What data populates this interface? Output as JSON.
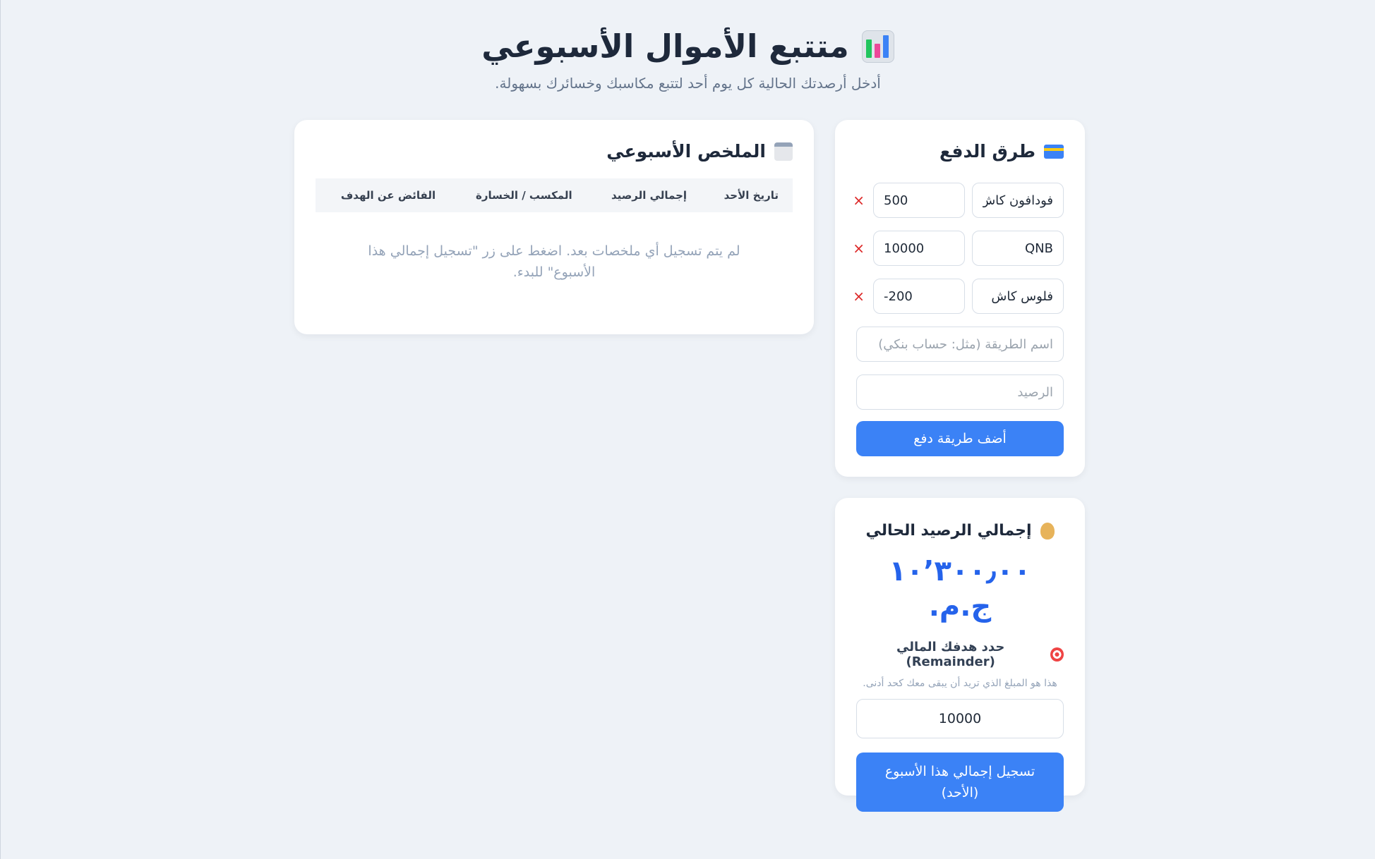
{
  "header": {
    "title": "متتبع الأموال الأسبوعي",
    "subtitle": "أدخل أرصدتك الحالية كل يوم أحد لتتبع مكاسبك وخسائرك بسهولة."
  },
  "payment": {
    "title": "طرق الدفع",
    "methods": [
      {
        "name": "فودافون كاش",
        "balance": "500"
      },
      {
        "name": "QNB",
        "balance": "10000"
      },
      {
        "name": "فلوس كاش",
        "balance": "-200"
      }
    ],
    "remove_label": "×",
    "name_placeholder": "اسم الطريقة (مثل: حساب بنكي)",
    "balance_placeholder": "الرصيد",
    "add_button": "أضف طريقة دفع"
  },
  "total": {
    "title": "إجمالي الرصيد الحالي",
    "value": "١٠٬٣٠٠٫٠٠ ج.م.",
    "goal_label": "حدد هدفك المالي (Remainder)",
    "goal_hint": "هذا هو المبلغ الذي تريد أن يبقى معك كحد أدنى.",
    "goal_value": "10000",
    "record_button": "تسجيل إجمالي هذا الأسبوع (الأحد)"
  },
  "summary": {
    "title": "الملخص الأسبوعي",
    "columns": [
      "تاريخ الأحد",
      "إجمالي الرصيد",
      "المكسب / الخسارة",
      "الفائض عن الهدف"
    ],
    "empty_message": "لم يتم تسجيل أي ملخصات بعد. اضغط على زر \"تسجيل إجمالي هذا الأسبوع\" للبدء."
  },
  "colors": {
    "accent": "#3b82f6",
    "total_value": "#2563eb",
    "remove": "#dc2626",
    "background": "#eef2f7"
  },
  "icons": {
    "title": "bar-chart-icon",
    "payment": "credit-card-icon",
    "total": "money-bag-icon",
    "goal": "target-icon",
    "summary": "calendar-icon"
  }
}
